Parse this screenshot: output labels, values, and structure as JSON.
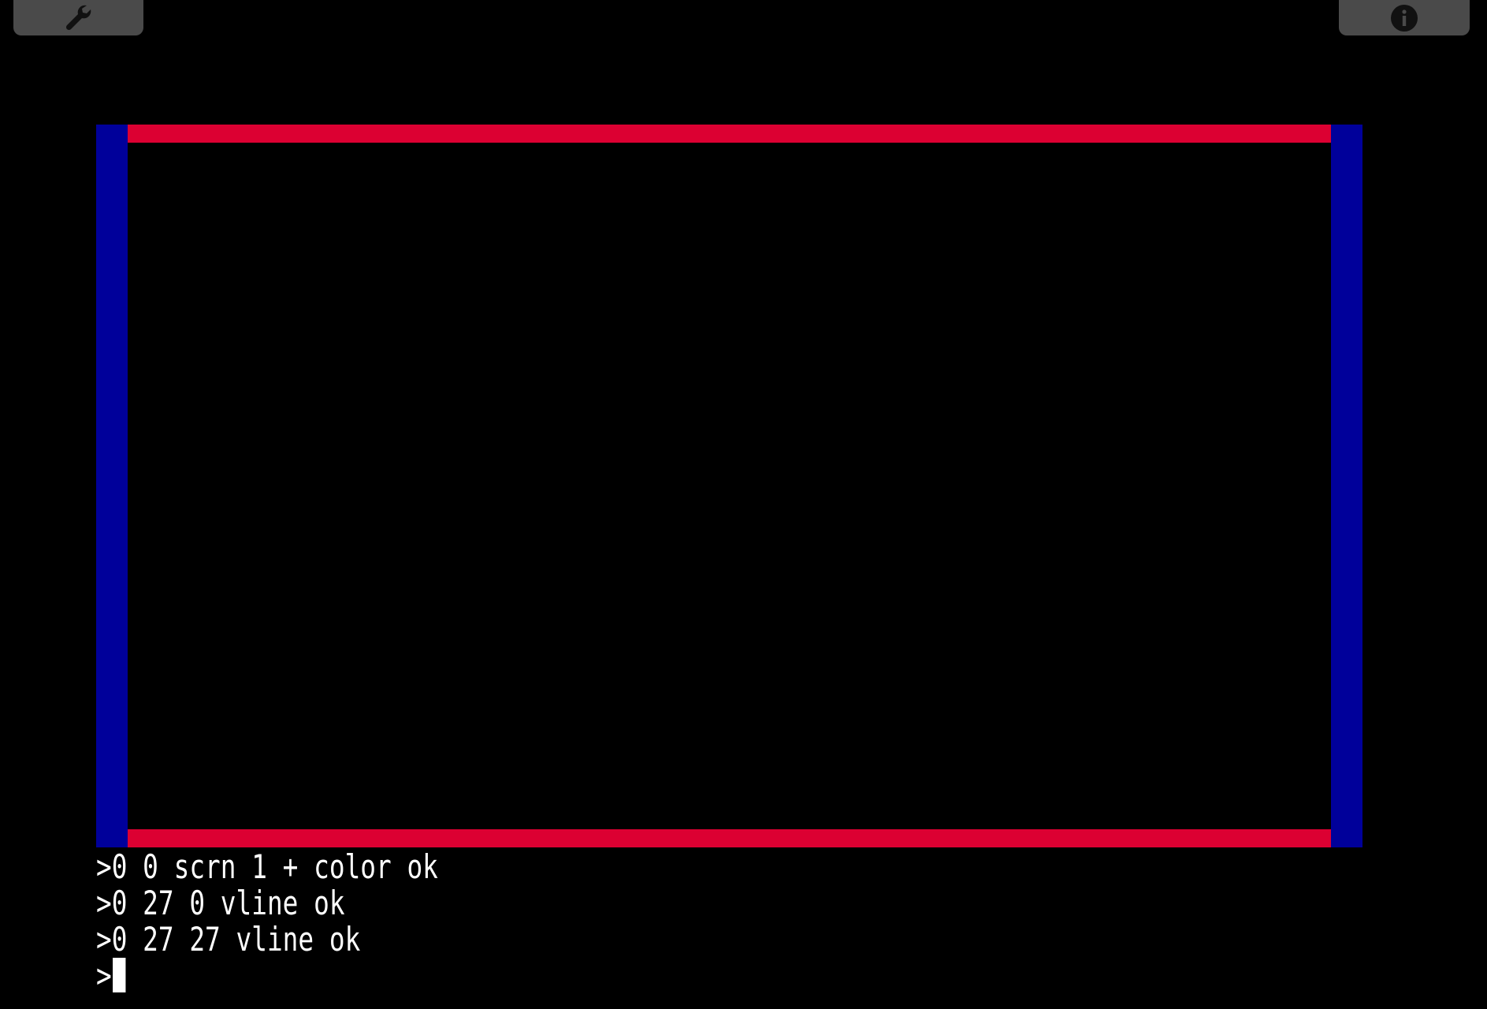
{
  "toolbar": {
    "settings_icon": "wrench-icon",
    "info_icon": "info-icon",
    "button_color": "#4a4a4a"
  },
  "screen": {
    "border_colors": {
      "horizontal": "#dc0032",
      "vertical": "#00009a"
    }
  },
  "console": {
    "lines": [
      ">0 0 scrn 1 + color ok",
      ">0 27 0 vline ok",
      ">0 27 27 vline ok"
    ],
    "prompt": ">"
  }
}
